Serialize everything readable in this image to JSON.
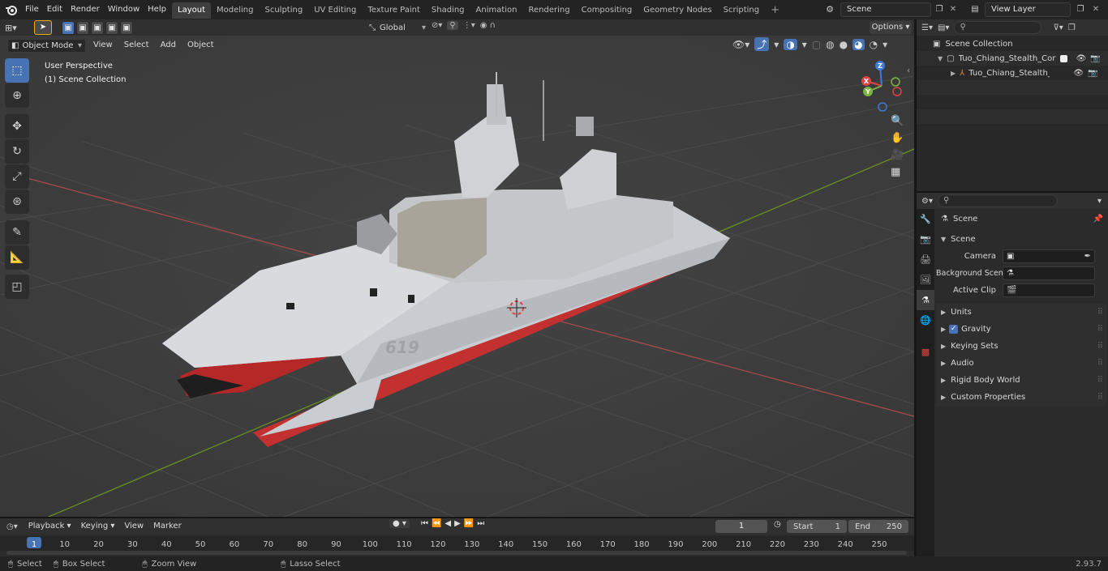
{
  "menus": [
    "File",
    "Edit",
    "Render",
    "Window",
    "Help"
  ],
  "workspaces": [
    "Layout",
    "Modeling",
    "Sculpting",
    "UV Editing",
    "Texture Paint",
    "Shading",
    "Animation",
    "Rendering",
    "Compositing",
    "Geometry Nodes",
    "Scripting"
  ],
  "active_workspace": "Layout",
  "scene_field": "Scene",
  "view_layer_field": "View Layer",
  "viewport_header": {
    "mode": "Object Mode",
    "menus": [
      "View",
      "Select",
      "Add",
      "Object"
    ],
    "transform_orientation": "Global",
    "options": "Options"
  },
  "viewport": {
    "perspective_label": "User Perspective",
    "collection_label": "(1) Scene Collection",
    "hull_number": "619",
    "gizmo": {
      "x": "X",
      "y": "Y",
      "z": "Z"
    }
  },
  "outliner": {
    "items": [
      {
        "label": "Scene Collection",
        "level": 0
      },
      {
        "label": "Tuo_Chiang_Stealth_Corvette",
        "level": 1
      },
      {
        "label": "Tuo_Chiang_Stealth_Con",
        "level": 2
      }
    ]
  },
  "properties": {
    "header_label": "Scene",
    "panel_title": "Scene",
    "fields": [
      {
        "label": "Camera",
        "value": ""
      },
      {
        "label": "Background Scene",
        "value": ""
      },
      {
        "label": "Active Clip",
        "value": ""
      }
    ],
    "panels": [
      "Units",
      "Gravity",
      "Keying Sets",
      "Audio",
      "Rigid Body World",
      "Custom Properties"
    ]
  },
  "timeline": {
    "menus": [
      "Playback",
      "Keying",
      "View",
      "Marker"
    ],
    "current_frame": "1",
    "start_label": "Start",
    "start_value": "1",
    "end_label": "End",
    "end_value": "250",
    "ticks": [
      "1",
      "10",
      "20",
      "30",
      "40",
      "50",
      "60",
      "70",
      "80",
      "90",
      "100",
      "110",
      "120",
      "130",
      "140",
      "150",
      "160",
      "170",
      "180",
      "190",
      "200",
      "210",
      "220",
      "230",
      "240",
      "250"
    ]
  },
  "statusbar": {
    "items": [
      "Select",
      "Box Select",
      "Zoom View",
      "Lasso Select"
    ],
    "version": "2.93.7"
  }
}
